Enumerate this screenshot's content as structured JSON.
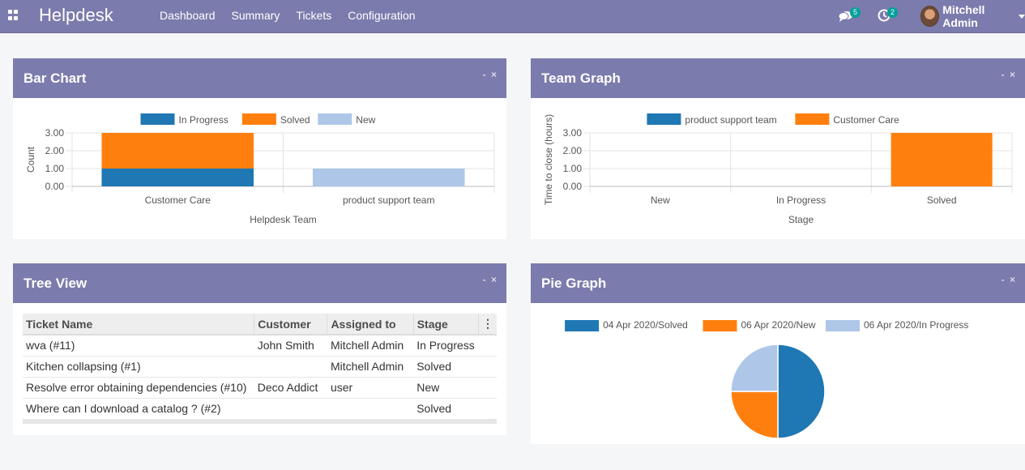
{
  "navbar": {
    "brand": "Helpdesk",
    "menu": [
      "Dashboard",
      "Summary",
      "Tickets",
      "Configuration"
    ],
    "chat_count": "5",
    "activity_count": "2",
    "user_name": "Mitchell Admin",
    "icons": [
      "apps-icon",
      "chat-icon",
      "activity-icon",
      "caret-down-icon"
    ]
  },
  "panels": {
    "bar": {
      "title": "Bar Chart",
      "ctrl_min": "-",
      "ctrl_close": "×"
    },
    "team": {
      "title": "Team Graph",
      "ctrl_min": "-",
      "ctrl_close": "×"
    },
    "tree": {
      "title": "Tree View",
      "ctrl_min": "-",
      "ctrl_close": "×"
    },
    "pie": {
      "title": "Pie Graph",
      "ctrl_min": "-",
      "ctrl_close": "×"
    }
  },
  "tree": {
    "columns": [
      "Ticket Name",
      "Customer",
      "Assigned to",
      "Stage"
    ],
    "column_menu": "⋮",
    "rows": [
      [
        "wva (#11)",
        "John Smith",
        "Mitchell Admin",
        "In Progress"
      ],
      [
        "Kitchen collapsing (#1)",
        "",
        "Mitchell Admin",
        "Solved"
      ],
      [
        "Resolve error obtaining dependencies (#10)",
        "Deco Addict",
        "user",
        "New"
      ],
      [
        "Where can I download a catalog ? (#2)",
        "",
        "",
        "Solved"
      ]
    ]
  },
  "colors": {
    "blue": "#1f77b4",
    "orange": "#ff7f0e",
    "light_blue": "#aec7e8",
    "header": "#7c7bad"
  },
  "chart_data": [
    {
      "type": "bar",
      "stacked": true,
      "categories": [
        "Customer Care",
        "product support team"
      ],
      "series": [
        {
          "name": "In Progress",
          "values": [
            1,
            0
          ]
        },
        {
          "name": "Solved",
          "values": [
            2,
            0
          ]
        },
        {
          "name": "New",
          "values": [
            0,
            1
          ]
        }
      ],
      "xlabel": "Helpdesk Team",
      "ylabel": "Count",
      "yticks": [
        "0.00",
        "1.00",
        "2.00",
        "3.00"
      ],
      "ylim": [
        0,
        3
      ],
      "legend": "top"
    },
    {
      "type": "bar",
      "categories": [
        "New",
        "In Progress",
        "Solved"
      ],
      "series": [
        {
          "name": "product support team",
          "values": [
            0,
            0,
            0
          ]
        },
        {
          "name": "Customer Care",
          "values": [
            0,
            0,
            3
          ]
        }
      ],
      "xlabel": "Stage",
      "ylabel": "Time to close (hours)",
      "yticks": [
        "0.00",
        "1.00",
        "2.00",
        "3.00"
      ],
      "ylim": [
        0,
        3
      ],
      "legend": "top"
    },
    {
      "type": "pie",
      "labels": [
        "04 Apr 2020/Solved",
        "06 Apr 2020/New",
        "06 Apr 2020/In Progress"
      ],
      "values": [
        2,
        1,
        1
      ],
      "legend": "top"
    }
  ]
}
